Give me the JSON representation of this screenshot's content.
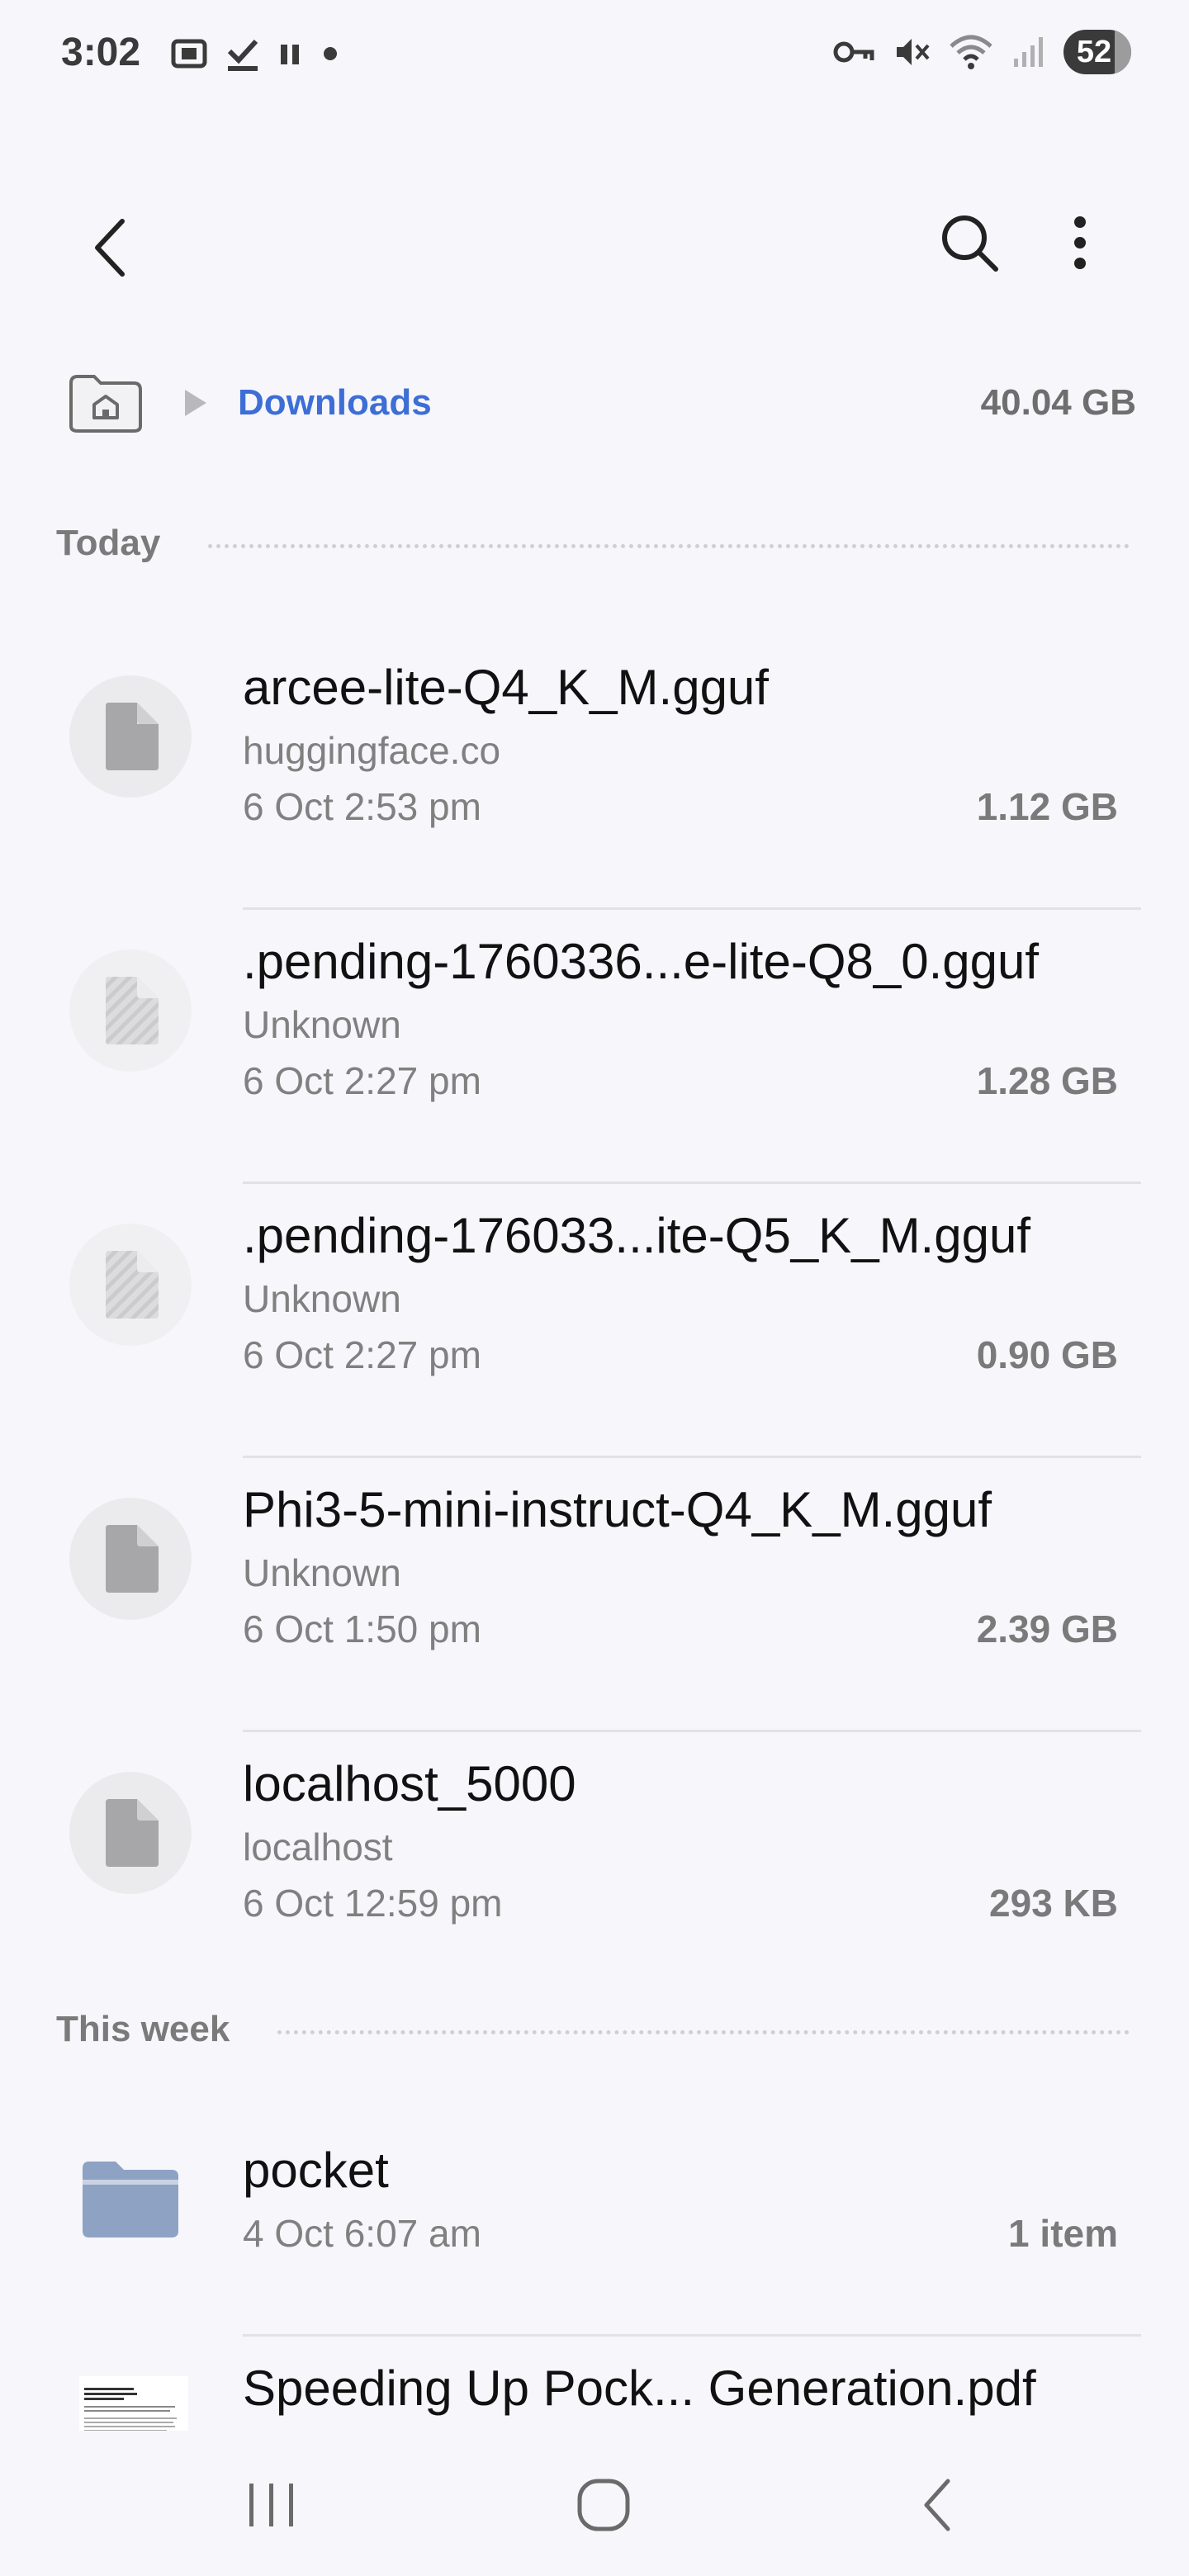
{
  "status_bar": {
    "time": "3:02",
    "battery": "52",
    "left_icons": [
      "screenshot-icon",
      "download-done-icon",
      "pause-icon",
      "dot-icon"
    ],
    "right_icons": [
      "vpn-key-icon",
      "mute-icon",
      "wifi-icon",
      "signal-icon"
    ]
  },
  "app_bar": {
    "back_icon": "back-icon",
    "search_icon": "search-icon",
    "more_icon": "more-vert-icon"
  },
  "breadcrumb": {
    "home_icon": "home-folder-icon",
    "current": "Downloads",
    "storage": "40.04 GB"
  },
  "sections": {
    "today": "Today",
    "this_week": "This week"
  },
  "files_today": [
    {
      "name": "arcee-lite-Q4_K_M.gguf",
      "source": "huggingface.co",
      "date": "6 Oct 2:53 pm",
      "size": "1.12 GB",
      "icon": "file-icon"
    },
    {
      "name": ".pending-1760336...e-lite-Q8_0.gguf",
      "source": "Unknown",
      "date": "6 Oct 2:27 pm",
      "size": "1.28 GB",
      "icon": "pending-file-icon"
    },
    {
      "name": ".pending-176033...ite-Q5_K_M.gguf",
      "source": "Unknown",
      "date": "6 Oct 2:27 pm",
      "size": "0.90 GB",
      "icon": "pending-file-icon"
    },
    {
      "name": "Phi3-5-mini-instruct-Q4_K_M.gguf",
      "source": "Unknown",
      "date": "6 Oct 1:50 pm",
      "size": "2.39 GB",
      "icon": "file-icon"
    },
    {
      "name": "localhost_5000",
      "source": "localhost",
      "date": "6 Oct 12:59 pm",
      "size": "293 KB",
      "icon": "file-icon"
    }
  ],
  "files_week": [
    {
      "name": "pocket",
      "date": "4 Oct 6:07 am",
      "size": "1 item",
      "icon": "folder-icon"
    },
    {
      "name": "Speeding Up Pock... Generation.pdf",
      "icon": "pdf-thumbnail"
    }
  ],
  "nav_bar": {
    "recents_icon": "recents-icon",
    "home_icon": "home-icon",
    "back_icon": "nav-back-icon"
  },
  "colors": {
    "accent": "#3d6ed6",
    "background": "#f7f6fb",
    "folder": "#8ea2c4"
  }
}
